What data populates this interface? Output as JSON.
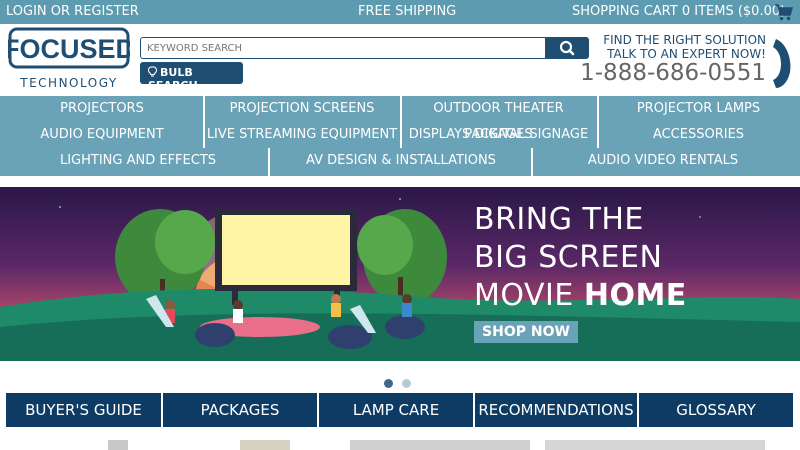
{
  "topbar": {
    "login": "LOGIN OR REGISTER",
    "shipping": "FREE SHIPPING",
    "cart": "SHOPPING CART 0 ITEMS ($0.00)"
  },
  "header": {
    "logo_text_main": "FOCUSED",
    "logo_text_sub": "TECHNOLOGY",
    "search_placeholder": "KEYWORD SEARCH",
    "bulb_search": "BULB SEARCH",
    "expert_line1": "FIND THE RIGHT SOLUTION",
    "expert_line2": "TALK TO AN EXPERT NOW!",
    "phone": "1-888-686-0551"
  },
  "nav": {
    "row1": [
      "PROJECTORS",
      "PROJECTION SCREENS",
      "OUTDOOR THEATER PACKAGES",
      "PROJECTOR LAMPS"
    ],
    "row2": [
      "AUDIO EQUIPMENT",
      "LIVE STREAMING EQUIPMENT",
      "DISPLAYS DIGITAL SIGNAGE",
      "ACCESSORIES"
    ],
    "row3": [
      "LIGHTING AND EFFECTS",
      "AV DESIGN & INSTALLATIONS",
      "AUDIO VIDEO RENTALS"
    ]
  },
  "hero": {
    "line1": "BRING THE",
    "line2": "BIG SCREEN",
    "line3_a": "MOVIE ",
    "line3_b": "HOME",
    "cta": "SHOP NOW"
  },
  "carousel": {
    "active_index": 0,
    "count": 2
  },
  "tabs": [
    "BUYER'S GUIDE",
    "PACKAGES",
    "LAMP CARE",
    "RECOMMENDATIONS",
    "GLOSSARY"
  ],
  "colors": {
    "topbar": "#5c9bb0",
    "brand_dark": "#1f4e73",
    "nav": "#6aa3b7",
    "tab": "#0d3b63"
  },
  "icons": {
    "cart": "shopping-cart-icon",
    "search": "magnifier-icon",
    "bulb": "lightbulb-icon",
    "phone": "phone-icon"
  }
}
